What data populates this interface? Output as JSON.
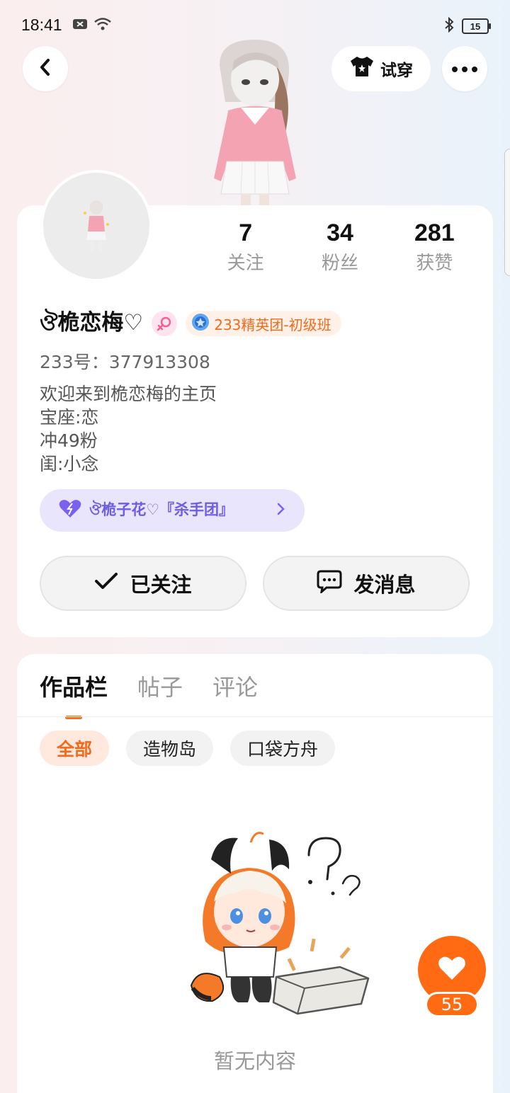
{
  "status_bar": {
    "time": "18:41",
    "battery": "15"
  },
  "header": {
    "tryon_label": "试穿"
  },
  "profile": {
    "username": "ঔ桅恋梅♡",
    "level_badge": "233精英团-初级班",
    "id_label": "233号：377913308",
    "bio": [
      "欢迎来到桅恋梅的主页",
      "宝座:恋",
      "冲49粉",
      "闺:小念"
    ],
    "stats": [
      {
        "value": "7",
        "label": "关注"
      },
      {
        "value": "34",
        "label": "粉丝"
      },
      {
        "value": "281",
        "label": "获赞"
      }
    ],
    "group_name": "ঔ桅子花♡『杀手团』",
    "follow_label": "已关注",
    "message_label": "发消息"
  },
  "content": {
    "tabs": [
      "作品栏",
      "帖子",
      "评论"
    ],
    "filters": [
      "全部",
      "造物岛",
      "口袋方舟"
    ],
    "empty_text": "暂无内容"
  },
  "like_count": "55",
  "colors": {
    "accent": "#ff6a13",
    "group": "#6c5ce7"
  }
}
